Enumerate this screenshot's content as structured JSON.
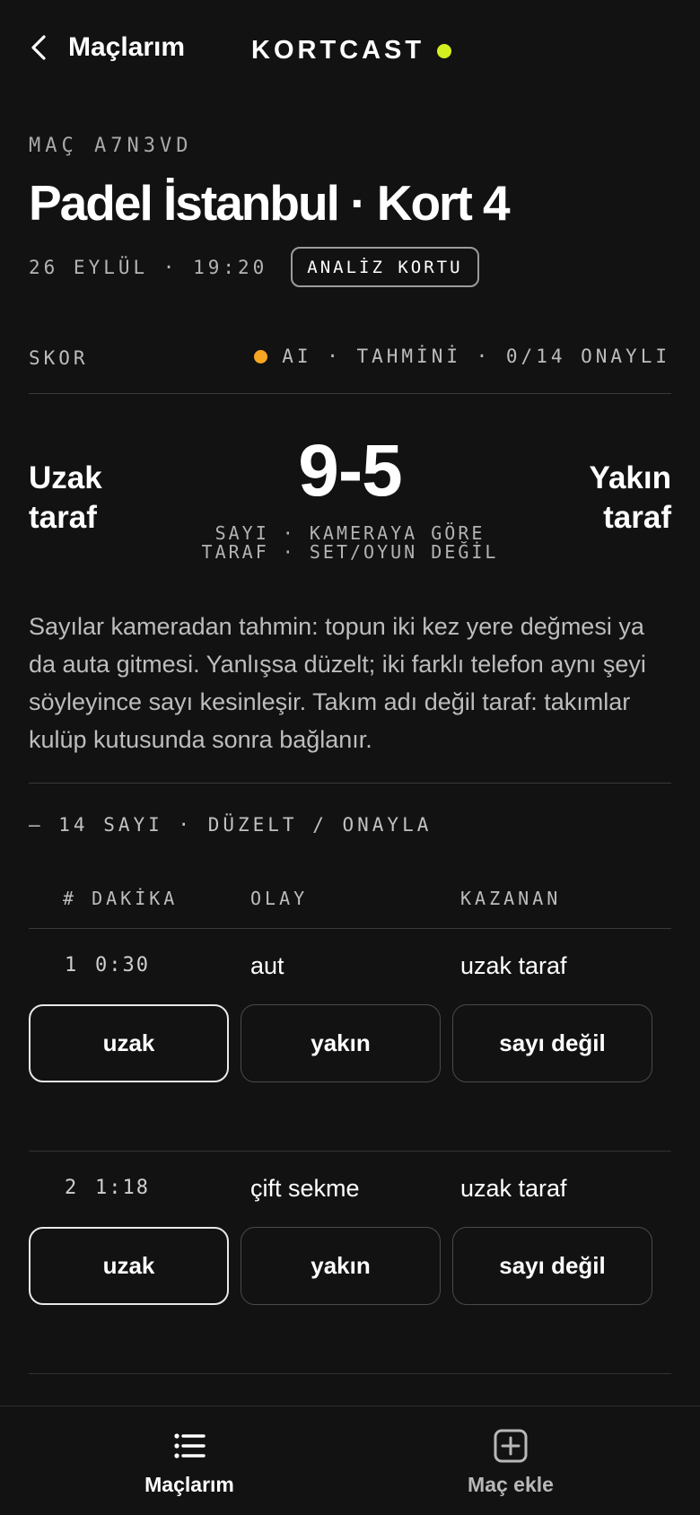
{
  "topbar": {
    "back_label": "Maçlarım",
    "brand": "KORTCAST",
    "brand_dot_color": "#d4ef1f",
    "back_icon": "chevron-left-icon"
  },
  "match": {
    "code": "MAÇ A7N3VD",
    "title": "Padel İstanbul · Kort 4",
    "datetime": "26 EYLÜL · 19:20",
    "analysis_button": "ANALİZ KORTU"
  },
  "score": {
    "label": "SKOR",
    "status": "AI · TAHMİNİ · 0/14 ONAYLI",
    "status_dot_color": "#f5a623",
    "left_side": [
      "Uzak",
      "taraf"
    ],
    "right_side": [
      "Yakın",
      "taraf"
    ],
    "value": "9-5",
    "caption_line1": "SAYI · KAMERAYA GÖRE",
    "caption_line2": "TARAF · SET/OYUN DEĞİL"
  },
  "explanation": "Sayılar kameradan tahmin: topun iki kez yere değmesi ya da auta gitmesi. Yanlışsa düzelt; iki farklı telefon aynı şeyi söyleyince sayı kesinleşir. Takım adı değil taraf: takımlar kulüp kutusunda sonra bağlanır.",
  "points_section": {
    "heading": "— 14 SAYI · DÜZELT / ONAYLA",
    "columns": {
      "number_minute": "# DAKİKA",
      "event": "OLAY",
      "winner": "KAZANAN"
    },
    "rows": [
      {
        "num": "1",
        "time": "0:30",
        "event": "aut",
        "winner": "uzak taraf",
        "options": [
          "uzak",
          "yakın",
          "sayı değil"
        ],
        "selected": "uzak"
      },
      {
        "num": "2",
        "time": "1:18",
        "event": "çift sekme",
        "winner": "uzak taraf",
        "options": [
          "uzak",
          "yakın",
          "sayı değil"
        ],
        "selected": "uzak"
      }
    ]
  },
  "bottom_nav": {
    "items": [
      {
        "label": "Maçlarım",
        "icon": "list-icon",
        "active": true
      },
      {
        "label": "Maç ekle",
        "icon": "add-square-icon",
        "active": false
      }
    ]
  }
}
